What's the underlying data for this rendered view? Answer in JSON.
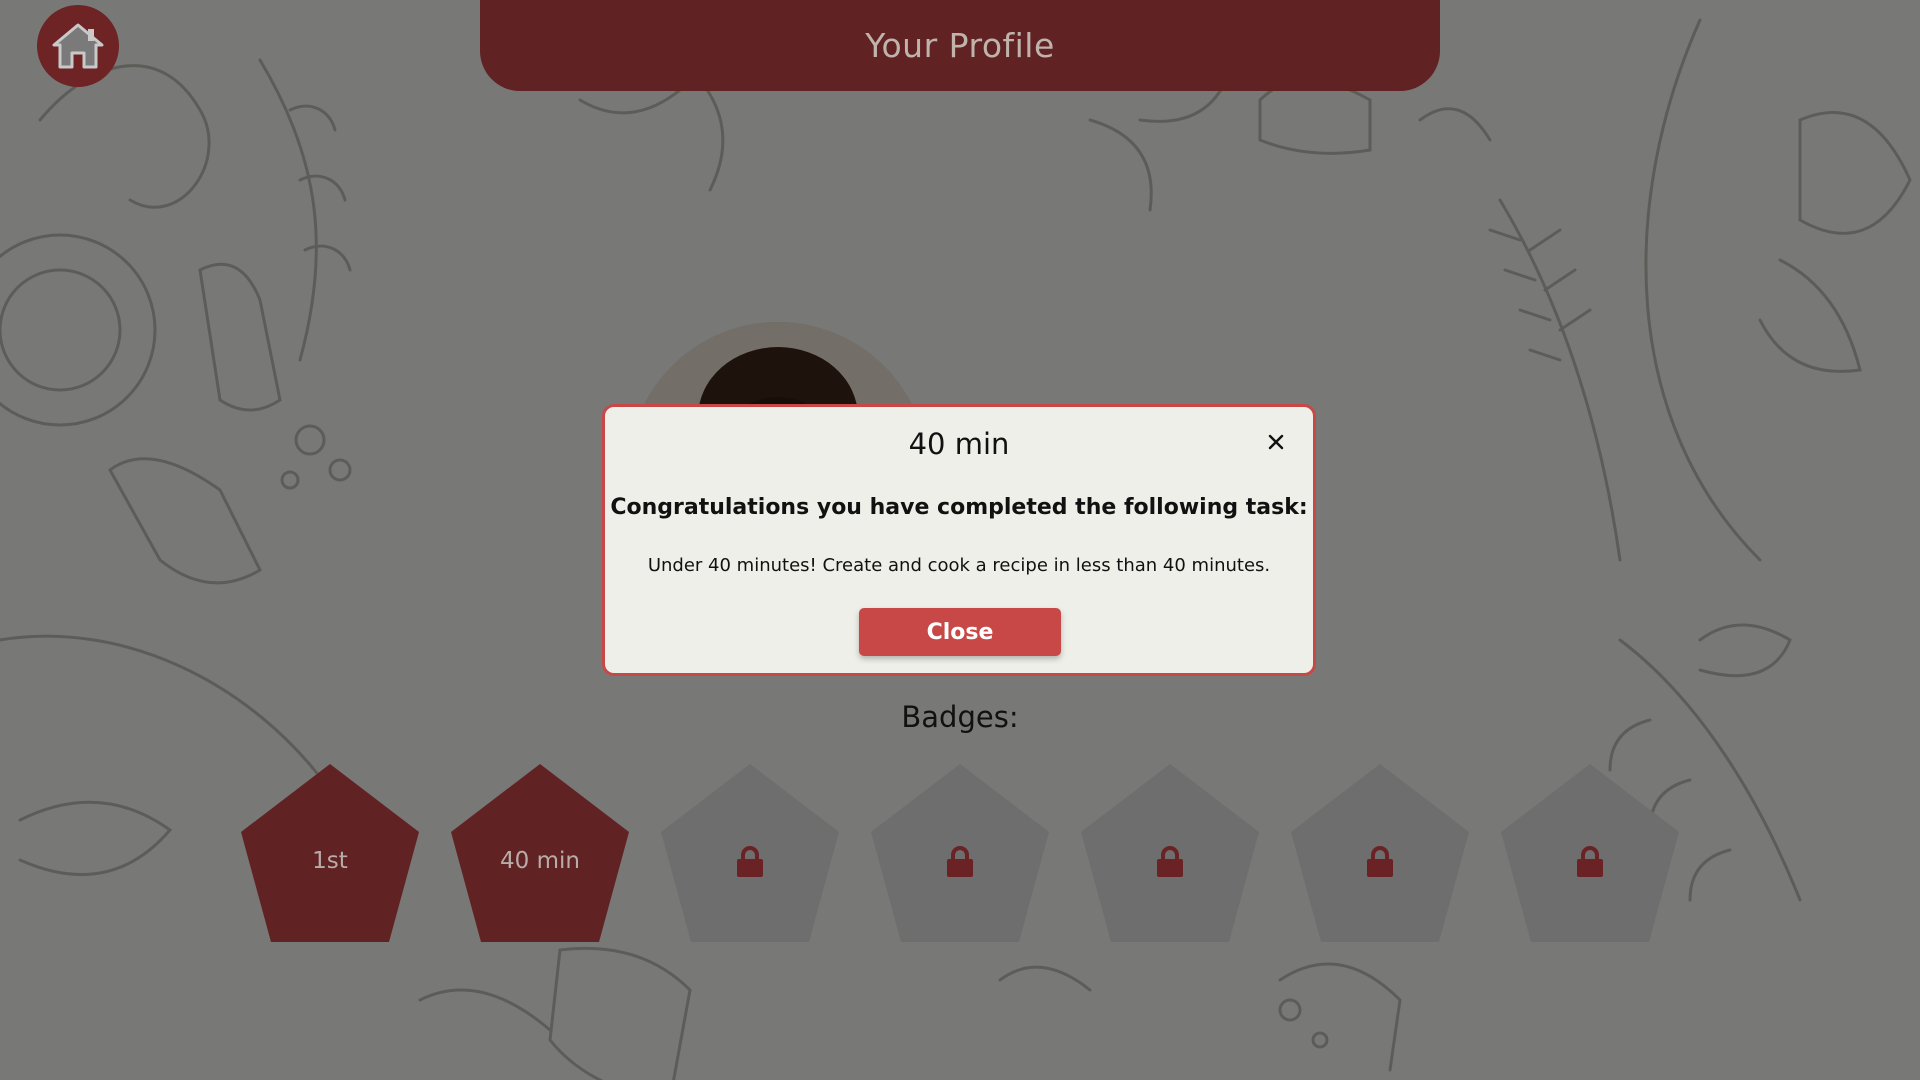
{
  "header": {
    "title": "Your Profile"
  },
  "home_button": {
    "icon": "home-icon"
  },
  "profile": {
    "avatar": "profile-photo"
  },
  "badges": {
    "title": "Badges:",
    "items": [
      {
        "label": "1st",
        "locked": false
      },
      {
        "label": "40 min",
        "locked": false
      },
      {
        "label": "",
        "locked": true,
        "icon": "lock-icon"
      },
      {
        "label": "",
        "locked": true,
        "icon": "lock-icon"
      },
      {
        "label": "",
        "locked": true,
        "icon": "lock-icon"
      },
      {
        "label": "",
        "locked": true,
        "icon": "lock-icon"
      },
      {
        "label": "",
        "locked": true,
        "icon": "lock-icon"
      }
    ]
  },
  "modal": {
    "title": "40 min",
    "close_icon": "close-icon",
    "heading": "Congratulations you have completed the following task:",
    "text": "Under 40 minutes! Create and cook a recipe in less than 40 minutes.",
    "button_label": "Close"
  },
  "colors": {
    "accent": "#c84848",
    "badge_unlocked": "#c14a4a",
    "badge_locked": "#dedede",
    "overlay": "rgba(0,0,0,0.5)"
  }
}
